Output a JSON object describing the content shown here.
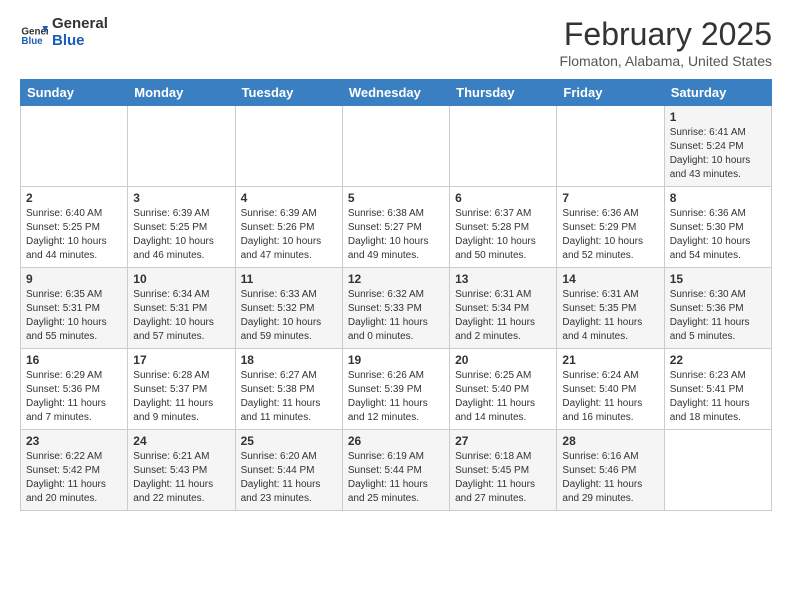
{
  "header": {
    "logo_line1": "General",
    "logo_line2": "Blue",
    "month_year": "February 2025",
    "location": "Flomaton, Alabama, United States"
  },
  "weekdays": [
    "Sunday",
    "Monday",
    "Tuesday",
    "Wednesday",
    "Thursday",
    "Friday",
    "Saturday"
  ],
  "weeks": [
    [
      {
        "day": "",
        "info": ""
      },
      {
        "day": "",
        "info": ""
      },
      {
        "day": "",
        "info": ""
      },
      {
        "day": "",
        "info": ""
      },
      {
        "day": "",
        "info": ""
      },
      {
        "day": "",
        "info": ""
      },
      {
        "day": "1",
        "info": "Sunrise: 6:41 AM\nSunset: 5:24 PM\nDaylight: 10 hours and 43 minutes."
      }
    ],
    [
      {
        "day": "2",
        "info": "Sunrise: 6:40 AM\nSunset: 5:25 PM\nDaylight: 10 hours and 44 minutes."
      },
      {
        "day": "3",
        "info": "Sunrise: 6:39 AM\nSunset: 5:25 PM\nDaylight: 10 hours and 46 minutes."
      },
      {
        "day": "4",
        "info": "Sunrise: 6:39 AM\nSunset: 5:26 PM\nDaylight: 10 hours and 47 minutes."
      },
      {
        "day": "5",
        "info": "Sunrise: 6:38 AM\nSunset: 5:27 PM\nDaylight: 10 hours and 49 minutes."
      },
      {
        "day": "6",
        "info": "Sunrise: 6:37 AM\nSunset: 5:28 PM\nDaylight: 10 hours and 50 minutes."
      },
      {
        "day": "7",
        "info": "Sunrise: 6:36 AM\nSunset: 5:29 PM\nDaylight: 10 hours and 52 minutes."
      },
      {
        "day": "8",
        "info": "Sunrise: 6:36 AM\nSunset: 5:30 PM\nDaylight: 10 hours and 54 minutes."
      }
    ],
    [
      {
        "day": "9",
        "info": "Sunrise: 6:35 AM\nSunset: 5:31 PM\nDaylight: 10 hours and 55 minutes."
      },
      {
        "day": "10",
        "info": "Sunrise: 6:34 AM\nSunset: 5:31 PM\nDaylight: 10 hours and 57 minutes."
      },
      {
        "day": "11",
        "info": "Sunrise: 6:33 AM\nSunset: 5:32 PM\nDaylight: 10 hours and 59 minutes."
      },
      {
        "day": "12",
        "info": "Sunrise: 6:32 AM\nSunset: 5:33 PM\nDaylight: 11 hours and 0 minutes."
      },
      {
        "day": "13",
        "info": "Sunrise: 6:31 AM\nSunset: 5:34 PM\nDaylight: 11 hours and 2 minutes."
      },
      {
        "day": "14",
        "info": "Sunrise: 6:31 AM\nSunset: 5:35 PM\nDaylight: 11 hours and 4 minutes."
      },
      {
        "day": "15",
        "info": "Sunrise: 6:30 AM\nSunset: 5:36 PM\nDaylight: 11 hours and 5 minutes."
      }
    ],
    [
      {
        "day": "16",
        "info": "Sunrise: 6:29 AM\nSunset: 5:36 PM\nDaylight: 11 hours and 7 minutes."
      },
      {
        "day": "17",
        "info": "Sunrise: 6:28 AM\nSunset: 5:37 PM\nDaylight: 11 hours and 9 minutes."
      },
      {
        "day": "18",
        "info": "Sunrise: 6:27 AM\nSunset: 5:38 PM\nDaylight: 11 hours and 11 minutes."
      },
      {
        "day": "19",
        "info": "Sunrise: 6:26 AM\nSunset: 5:39 PM\nDaylight: 11 hours and 12 minutes."
      },
      {
        "day": "20",
        "info": "Sunrise: 6:25 AM\nSunset: 5:40 PM\nDaylight: 11 hours and 14 minutes."
      },
      {
        "day": "21",
        "info": "Sunrise: 6:24 AM\nSunset: 5:40 PM\nDaylight: 11 hours and 16 minutes."
      },
      {
        "day": "22",
        "info": "Sunrise: 6:23 AM\nSunset: 5:41 PM\nDaylight: 11 hours and 18 minutes."
      }
    ],
    [
      {
        "day": "23",
        "info": "Sunrise: 6:22 AM\nSunset: 5:42 PM\nDaylight: 11 hours and 20 minutes."
      },
      {
        "day": "24",
        "info": "Sunrise: 6:21 AM\nSunset: 5:43 PM\nDaylight: 11 hours and 22 minutes."
      },
      {
        "day": "25",
        "info": "Sunrise: 6:20 AM\nSunset: 5:44 PM\nDaylight: 11 hours and 23 minutes."
      },
      {
        "day": "26",
        "info": "Sunrise: 6:19 AM\nSunset: 5:44 PM\nDaylight: 11 hours and 25 minutes."
      },
      {
        "day": "27",
        "info": "Sunrise: 6:18 AM\nSunset: 5:45 PM\nDaylight: 11 hours and 27 minutes."
      },
      {
        "day": "28",
        "info": "Sunrise: 6:16 AM\nSunset: 5:46 PM\nDaylight: 11 hours and 29 minutes."
      },
      {
        "day": "",
        "info": ""
      }
    ]
  ]
}
